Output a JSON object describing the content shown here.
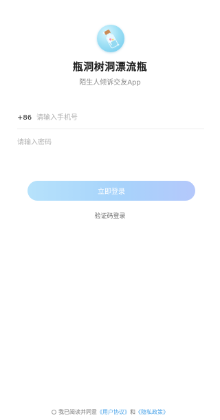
{
  "app": {
    "title": "瓶洞树洞漂流瓶",
    "subtitle": "陌生人倾诉交友App",
    "logo_icon": "bottle-icon"
  },
  "login_form": {
    "country_code": "+86",
    "phone_placeholder": "请输入手机号",
    "password_placeholder": "请输入密码",
    "submit_label": "立即登录",
    "alt_login_label": "验证码登录"
  },
  "agreement": {
    "checked": false,
    "prefix": "我已阅读并同意",
    "user_agreement": "《用户协议》",
    "conjunction": "和",
    "privacy_policy": "《隐私政策》"
  },
  "colors": {
    "accent": "#a7d3fb",
    "link": "#4aa3e8"
  }
}
